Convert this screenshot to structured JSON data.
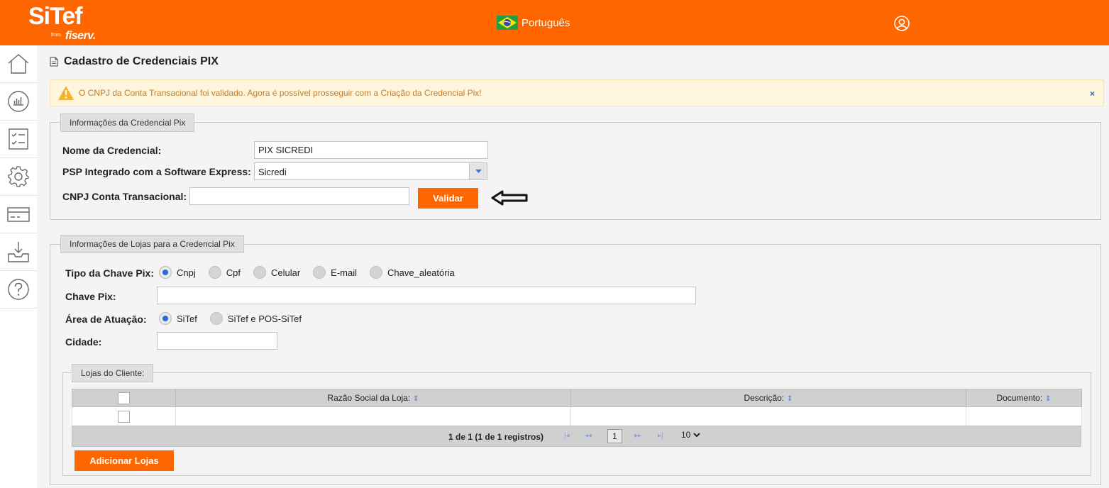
{
  "header": {
    "logo_text": "SiTef",
    "logo_from": "from",
    "logo_brand": "fiserv.",
    "language": "Português",
    "user_icon": "user-circle-icon",
    "flag_icon": "brazil-flag-icon"
  },
  "colors": {
    "brand": "#ff6600",
    "sidebar": "#ffffff",
    "background": "#f4f4f4",
    "radio_active": "#2a6dd6",
    "alert_text": "#c47d2c"
  },
  "sidebar": {
    "items": [
      {
        "name": "home",
        "icon": "home-icon"
      },
      {
        "name": "reports",
        "icon": "chart-icon"
      },
      {
        "name": "tasks",
        "icon": "checklist-icon"
      },
      {
        "name": "settings",
        "icon": "gear-icon"
      },
      {
        "name": "cards",
        "icon": "credit-card-icon"
      },
      {
        "name": "download",
        "icon": "inbox-download-icon"
      },
      {
        "name": "help",
        "icon": "help-icon"
      }
    ]
  },
  "page": {
    "title": "Cadastro de Credenciais PIX",
    "alert": {
      "text": "O CNPJ da Conta Transacional foi validado. Agora é possível prosseguir com a Criação da Credencial Pix!",
      "close": "×"
    }
  },
  "credential": {
    "legend": "Informações da Credencial Pix",
    "name_label": "Nome da Credencial:",
    "name_value": "PIX SICREDI",
    "psp_label": "PSP Integrado com a Software Express:",
    "psp_value": "Sicredi",
    "cnpj_label": "CNPJ Conta Transacional:",
    "cnpj_value": "",
    "validate_button": "Validar"
  },
  "stores": {
    "legend": "Informações de Lojas para a Credencial Pix",
    "key_type_label": "Tipo da Chave Pix:",
    "key_types": [
      {
        "label": "Cnpj",
        "checked": true
      },
      {
        "label": "Cpf",
        "checked": false
      },
      {
        "label": "Celular",
        "checked": false
      },
      {
        "label": "E-mail",
        "checked": false
      },
      {
        "label": "Chave_aleatória",
        "checked": false
      }
    ],
    "key_label": "Chave Pix:",
    "key_value": "",
    "area_label": "Área de Atuação:",
    "areas": [
      {
        "label": "SiTef",
        "checked": true
      },
      {
        "label": "SiTef e POS-SiTef",
        "checked": false
      }
    ],
    "city_label": "Cidade:",
    "city_value": "",
    "client_stores": {
      "legend": "Lojas do Cliente:",
      "columns": [
        "Razão Social da Loja:",
        "Descrição:",
        "Documento:"
      ],
      "sort_icon": "⇕",
      "pager": {
        "summary": "1 de 1 (1 de 1 registros)",
        "first": "|◂",
        "prev": "◂◂",
        "next": "▸▸",
        "last": "▸|",
        "current_page": "1",
        "page_size": "10"
      },
      "add_button": "Adicionar Lojas"
    }
  }
}
